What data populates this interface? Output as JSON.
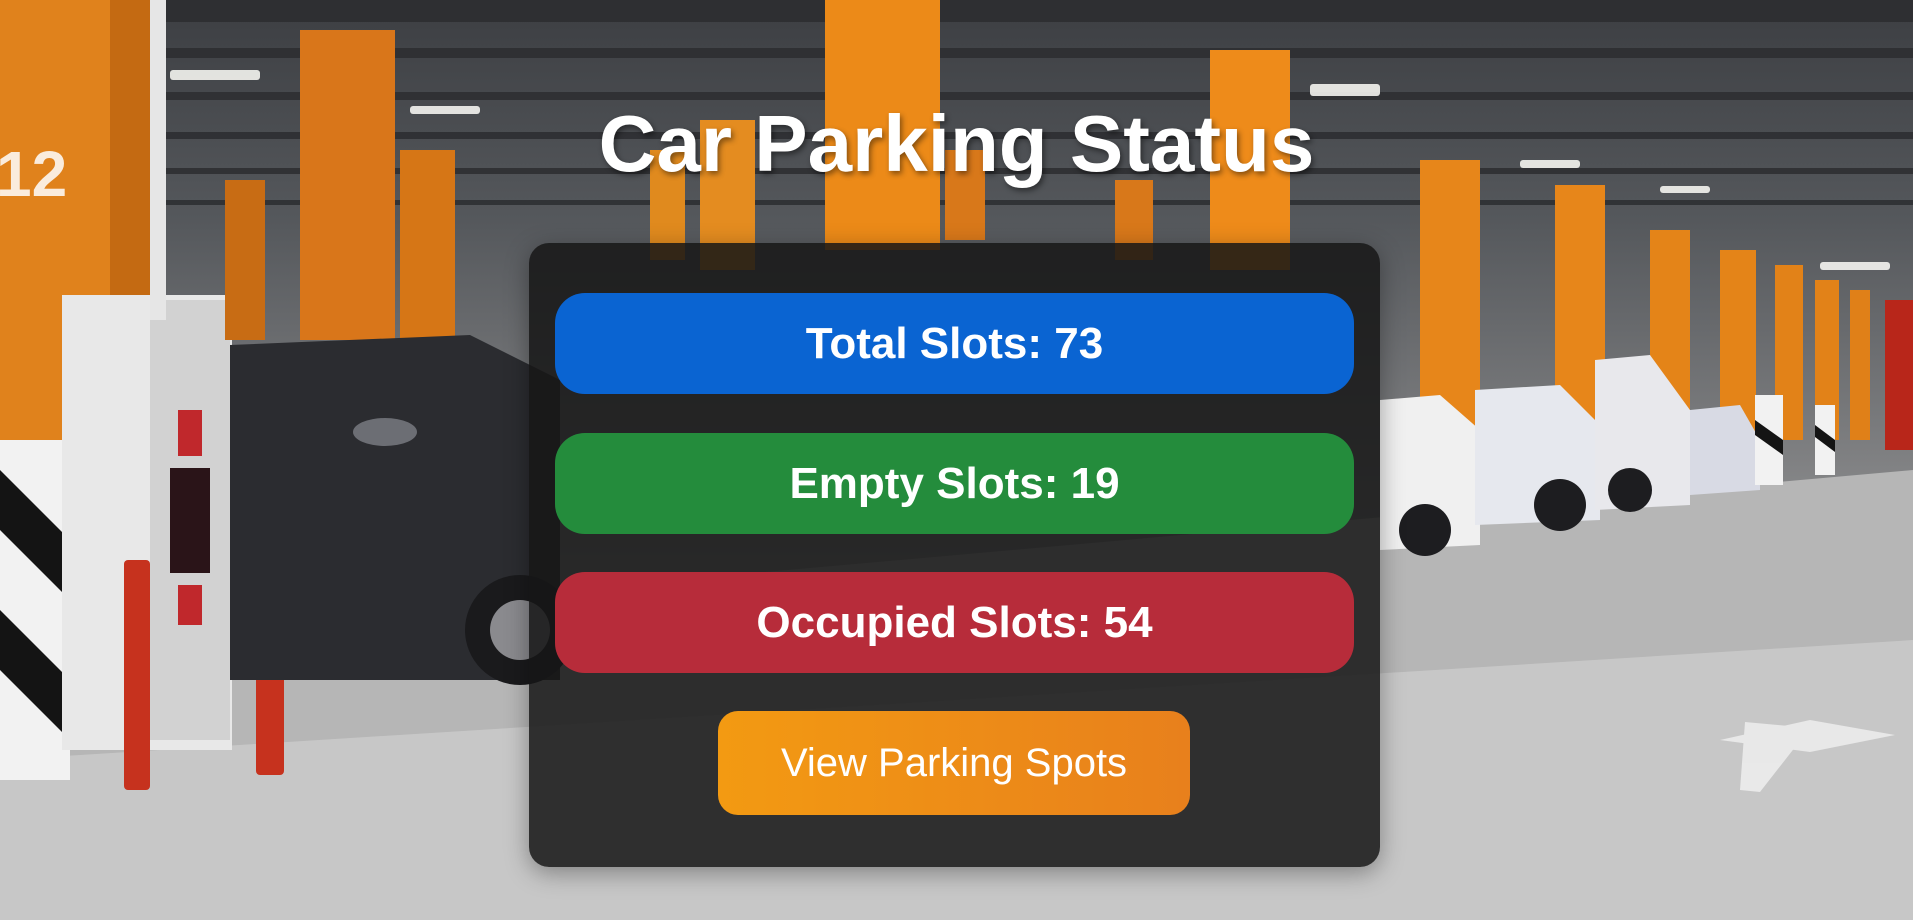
{
  "page": {
    "title": "Car Parking Status"
  },
  "stats": [
    {
      "label": "Total Slots",
      "value": "73",
      "color": "#0a64d2"
    },
    {
      "label": "Empty Slots",
      "value": "19",
      "color": "#248c3c"
    },
    {
      "label": "Occupied Slots",
      "value": "54",
      "color": "#b72c3a"
    }
  ],
  "actions": {
    "view_spots_label": "View Parking Spots",
    "view_spots_color": "#f0900f"
  },
  "background": {
    "pillar_number": "12",
    "theme": "underground parking garage photo"
  }
}
